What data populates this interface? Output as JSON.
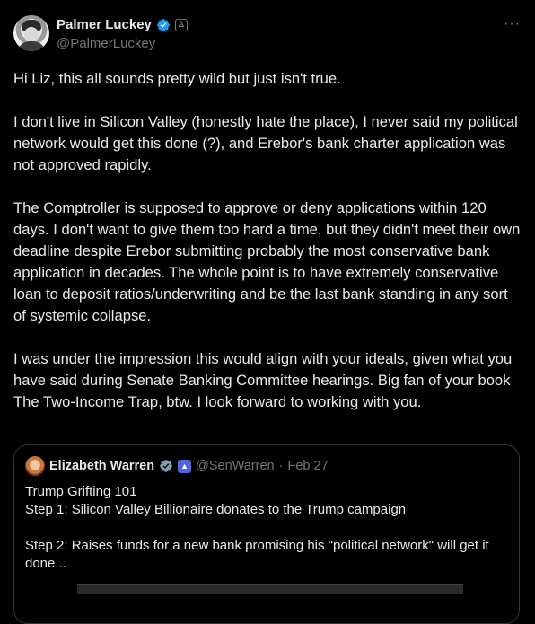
{
  "author": {
    "name": "Palmer Luckey",
    "handle": "@PalmerLuckey"
  },
  "post": {
    "paragraphs": [
      "Hi Liz, this all sounds pretty wild but just isn't true.",
      "I don't live in Silicon Valley (honestly hate the place), I never said my political network would get this done (?), and Erebor's bank charter application was not approved rapidly.",
      "The Comptroller is supposed to approve or deny applications within 120 days.  I don't want to give them too hard a time, but they didn't meet their own deadline despite Erebor submitting probably the most conservative bank application in decades.  The whole point is to have extremely conservative loan to deposit ratios/underwriting and be the last bank standing in any sort of systemic collapse.",
      "I was under the impression this would align with your ideals, given what you have said during Senate Banking Committee hearings.  Big fan of your book The Two-Income Trap, btw.  I look forward to working with you."
    ]
  },
  "quoted": {
    "name": "Elizabeth Warren",
    "handle": "@SenWarren",
    "separator": "·",
    "date": "Feb 27",
    "lines": [
      "Trump Grifting 101",
      "Step 1: Silicon Valley Billionaire donates to the Trump campaign",
      "Step 2: Raises funds for a new bank promising his \"political network\" will get it done..."
    ]
  },
  "more_label": "···",
  "colors": {
    "background": "#000000",
    "text": "#e7e9ea",
    "muted": "#71767b",
    "verified": "#1d9bf0",
    "gov_badge": "#4d67d6"
  },
  "icons": [
    "verified-badge-icon",
    "affiliation-badge-icon",
    "more-options-icon",
    "government-badge-icon"
  ]
}
